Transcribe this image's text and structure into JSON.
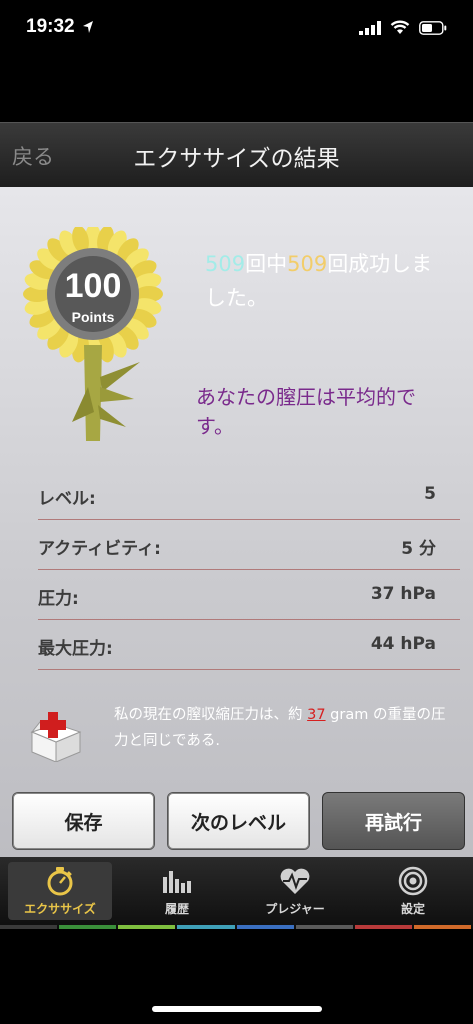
{
  "status": {
    "time": "19:32"
  },
  "nav": {
    "back_label": "戻る",
    "title": "エクササイズの結果"
  },
  "medal": {
    "points": "100",
    "points_label": "Points"
  },
  "result": {
    "success_count": "509",
    "sep1": "回中",
    "total_count": "509",
    "sep2": "回成功しました。"
  },
  "assessment": "あなたの膣圧は平均的です。",
  "stats": [
    {
      "label": "レベル:",
      "value": "5"
    },
    {
      "label": "アクティビティ:",
      "value": "5 分"
    },
    {
      "label": "圧力:",
      "value": "37 hPa"
    },
    {
      "label": "最大圧力:",
      "value": "44 hPa"
    }
  ],
  "info": {
    "before": "私の現在の膣収縮圧力は、約 ",
    "weight": "37",
    "after": " gram の重量の圧力と同じである."
  },
  "buttons": {
    "save": "保存",
    "next_level": "次のレベル",
    "retry": "再試行"
  },
  "tabs": [
    {
      "label": "エクササイズ",
      "icon": "stopwatch-icon",
      "active": true
    },
    {
      "label": "履歴",
      "icon": "bar-chart-icon",
      "active": false
    },
    {
      "label": "プレジャー",
      "icon": "heart-pulse-icon",
      "active": false
    },
    {
      "label": "設定",
      "icon": "target-icon",
      "active": false
    }
  ],
  "colors": {
    "accent_yellow": "#e9c548",
    "assessment_purple": "#7a2a8c",
    "highlight_cyan": "#a3ece8",
    "highlight_yellow": "#f2cd6a",
    "warning_red": "#d62020",
    "tab_strip": [
      "#3a8f3a",
      "#7fbf3f",
      "#3fa0b8",
      "#3a6fc0",
      "#b83a3a",
      "#d06a2a"
    ]
  }
}
